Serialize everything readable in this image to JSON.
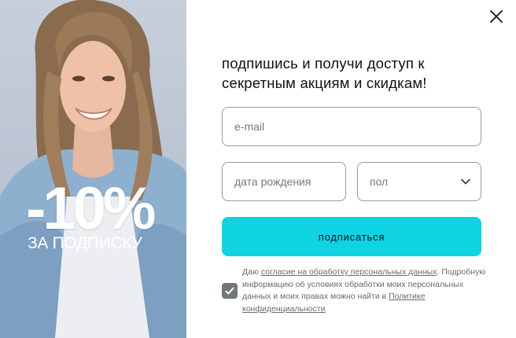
{
  "promo": {
    "discount": "-10%",
    "subtitle": "ЗА ПОДПИСКУ"
  },
  "headline": {
    "line1": "подпишись и получи доступ к",
    "line2": "секретным акциям и скидкам!"
  },
  "form": {
    "email_placeholder": "e-mail",
    "dob_placeholder": "дата рождения",
    "gender_placeholder": "пол",
    "submit_label": "подписаться"
  },
  "consent": {
    "prefix": "Даю ",
    "link1": "согласие на обработку персональных данных",
    "middle": ". Подробную информацию об условиях обработки моих персональных данных и моих правах можно найти в ",
    "link2": "Политике конфиденциальности",
    "checked": true
  },
  "colors": {
    "accent": "#0fd2e3",
    "checkbox": "#6f7a77",
    "border": "#9a9a9a"
  },
  "icons": {
    "close": "close-icon",
    "chevron": "chevron-down-icon",
    "check": "check-icon"
  }
}
